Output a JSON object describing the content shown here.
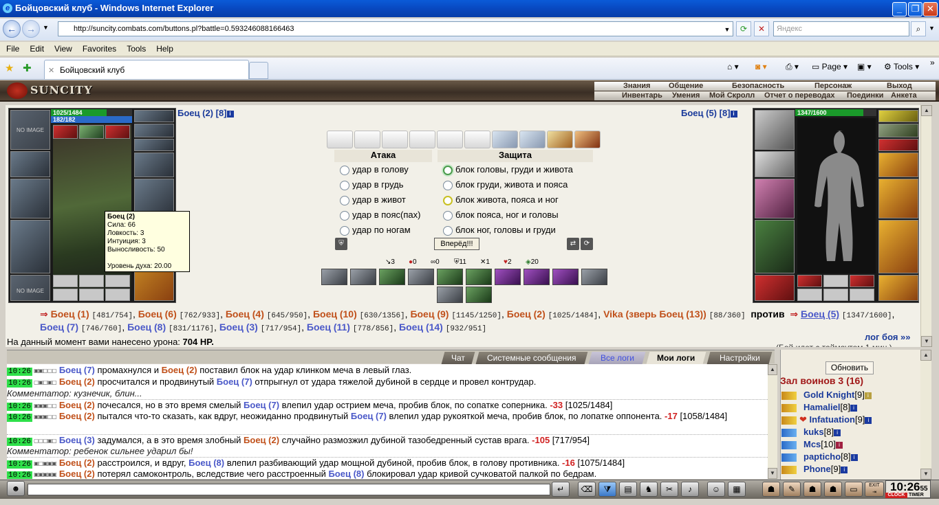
{
  "window": {
    "title": "Бойцовский клуб - Windows Internet Explorer"
  },
  "address": {
    "url": "http://suncity.combats.com/buttons.pl?battle=0.593246088166463",
    "search_placeholder": "Яндекс"
  },
  "menu": [
    "File",
    "Edit",
    "View",
    "Favorites",
    "Tools",
    "Help"
  ],
  "tab": {
    "title": "Бойцовский клуб"
  },
  "toolbar": {
    "page": "Page",
    "tools": "Tools"
  },
  "game": {
    "logo": "SUNCITY",
    "nav_top": [
      "Знания",
      "Общение",
      "Безопасность",
      "Персонаж",
      "Выход"
    ],
    "nav_bottom": [
      "Инвентарь",
      "Умения",
      "Мой Скролл",
      "Отчет о переводах",
      "Поединки",
      "Анкета"
    ]
  },
  "left_fighter": {
    "name": "Боец (2)",
    "level": "[8]",
    "hp": "1025/1484",
    "mana": "182/182",
    "hp_fraction": 0.69,
    "no_image": "NO IMAGE",
    "tooltip": {
      "name": "Боец (2)",
      "lines": [
        "Сила: 66",
        "Ловкость: 3",
        "Интуиция: 3",
        "Выносливость: 50"
      ],
      "spirit": "Уровень духа: 20.00"
    }
  },
  "right_fighter": {
    "name": "Боец (5)",
    "level": "[8]",
    "hp": "1347/1600",
    "hp_fraction": 0.84
  },
  "attack": {
    "title": "Атака",
    "options": [
      "удар в голову",
      "удар в грудь",
      "удар в живот",
      "удар в пояс(пах)",
      "удар по ногам"
    ]
  },
  "defense": {
    "title": "Защита",
    "options": [
      "блок головы, груди и живота",
      "блок груди, живота и пояса",
      "блок живота, пояса и ног",
      "блок пояса, ног и головы",
      "блок ног, головы и груди"
    ]
  },
  "go_button": "Вперёд!!!",
  "stats": [
    "3",
    "0",
    "0",
    "11",
    "1",
    "2",
    "20"
  ],
  "fighters_line": {
    "team1": [
      {
        "name": "Боец (1)",
        "hp": "[481/754]"
      },
      {
        "name": "Боец (6)",
        "hp": "[762/933]"
      },
      {
        "name": "Боец (4)",
        "hp": "[645/950]"
      },
      {
        "name": "Боец (10)",
        "hp": "[630/1356]"
      },
      {
        "name": "Боец (9)",
        "hp": "[1145/1250]"
      },
      {
        "name": "Боец (2)",
        "hp": "[1025/1484]"
      },
      {
        "name": "Vika (зверь Боец (13))",
        "hp": "[88/360]"
      }
    ],
    "versus": "против",
    "team2": [
      {
        "name": "Боец (5)",
        "hp": "[1347/1600]"
      },
      {
        "name": "Боец (7)",
        "hp": "[746/760]"
      },
      {
        "name": "Боец (8)",
        "hp": "[831/1176]"
      },
      {
        "name": "Боец (3)",
        "hp": "[717/954]"
      },
      {
        "name": "Боец (11)",
        "hp": "[778/856]"
      },
      {
        "name": "Боец (14)",
        "hp": "[932/951]"
      }
    ]
  },
  "damage": {
    "label": "На данный момент вами нанесено урона:",
    "value": "704 HP."
  },
  "log_link": "лог боя »»",
  "log_cut": "(Бой идет с таймаутом 1 мин.)",
  "chat_tabs": [
    "Чат",
    "Системные сообщения",
    "Все логи",
    "Мои логи",
    "Настройки"
  ],
  "log": {
    "time": "10:26",
    "l1": {
      "a": "Боец (7)",
      "t1": " промахнулся и ",
      "b": "Боец (2)",
      "t2": " поставил блок на удар клинком меча в левый глаз."
    },
    "l2": {
      "a": "Боец (2)",
      "t1": " просчитался и продвинутый ",
      "b": "Боец (7)",
      "t2": " отпрыгнул от удара тяжелой дубиной в сердце и провел контрудар."
    },
    "c1": "Комментатор: кузнечик, блин...",
    "l3": {
      "a": "Боец (2)",
      "t1": " почесался, но в это время смелый ",
      "b": "Боец (7)",
      "t2": " влепил удар острием меча, пробив блок, по сопатке соперника. ",
      "dmg": "-33",
      "hp": " [1025/1484]"
    },
    "l4": {
      "a": "Боец (2)",
      "t1": " пытался что-то сказать, как вдруг, неожиданно продвинутый ",
      "b": "Боец (7)",
      "t2": " влепил удар рукояткой меча, пробив блок, по лопатке оппонента. ",
      "dmg": "-17",
      "hp": " [1058/1484]"
    },
    "l5": {
      "a": "Боец (3)",
      "t1": " задумался, а в это время злобный ",
      "b": "Боец (2)",
      "t2": " случайно размозжил дубиной тазобедренный сустав врага. ",
      "dmg": "-105",
      "hp": " [717/954]"
    },
    "c2": "Комментатор: ребенок сильнее ударил бы!",
    "l6": {
      "a": "Боец (2)",
      "t1": " расстроился, и вдруг, ",
      "b": "Боец (8)",
      "t2": " влепил разбивающий удар мощной дубиной, пробив блок, в голову противника. ",
      "dmg": "-16",
      "hp": " [1075/1484]"
    },
    "l7": {
      "a": "Боец (2)",
      "t1": " потерял самоконтроль, вследствие чего расстроенный ",
      "b": "Боец (8)",
      "t2": " блокировал удар кривой сучковатой палкой по бедрам."
    }
  },
  "room": {
    "refresh": "Обновить",
    "title": "Зал воинов 3 (16)",
    "users": [
      {
        "name": "Gold Knight",
        "level": "[9]"
      },
      {
        "name": "Hamaliel",
        "level": "[8]"
      },
      {
        "name": "Infatuation",
        "level": "[9]"
      },
      {
        "name": "kuks",
        "level": "[8]"
      },
      {
        "name": "Mcs",
        "level": "[10]"
      },
      {
        "name": "papticho",
        "level": "[8]"
      },
      {
        "name": "Phone",
        "level": "[9]"
      }
    ]
  },
  "clock": {
    "time": "10:26",
    "seconds": "55",
    "clock_label": "CLOCK",
    "timer_label": "TIMER",
    "exit": "EXIT"
  }
}
